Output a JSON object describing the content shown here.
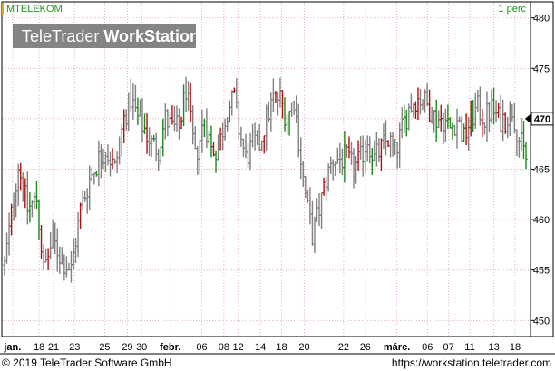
{
  "header": {
    "symbol": "MTELEKOM",
    "interval": "1 perc"
  },
  "watermark": {
    "brand_light": "TeleTrader",
    "brand_bold": "WorkStation"
  },
  "footer": {
    "copyright": "© 2019 TeleTrader Software GmbH",
    "url": "https://workstation.teletrader.com"
  },
  "colors": {
    "up": "#1a8a1a",
    "down": "#b01010",
    "neutral": "#808080",
    "grid": "#e6b3b3",
    "header_text": "#1a9a1a",
    "watermark_bg": "#7a7a7a",
    "symbol_marker": "#f0a020",
    "last_price_marker": "#000000"
  },
  "chart_data": {
    "type": "ohlc",
    "title": "MTELEKOM",
    "interval": "1 perc",
    "xlabel": "",
    "ylabel": "",
    "ylim": [
      448.5,
      481.5
    ],
    "y_ticks": [
      450,
      455,
      460,
      465,
      470,
      475,
      480
    ],
    "last_price": 470,
    "grid": true,
    "x_ticks": [
      {
        "label": "jan.",
        "bold": true,
        "pos": 0.02
      },
      {
        "label": "18",
        "bold": false,
        "pos": 0.074
      },
      {
        "label": "21",
        "bold": false,
        "pos": 0.103
      },
      {
        "label": "23",
        "bold": false,
        "pos": 0.146
      },
      {
        "label": "25",
        "bold": false,
        "pos": 0.207
      },
      {
        "label": "29",
        "bold": false,
        "pos": 0.253
      },
      {
        "label": "30",
        "bold": false,
        "pos": 0.282
      },
      {
        "label": "febr.",
        "bold": true,
        "pos": 0.34
      },
      {
        "label": "06",
        "bold": false,
        "pos": 0.404
      },
      {
        "label": "08",
        "bold": false,
        "pos": 0.449
      },
      {
        "label": "12",
        "bold": false,
        "pos": 0.478
      },
      {
        "label": "14",
        "bold": false,
        "pos": 0.523
      },
      {
        "label": "18",
        "bold": false,
        "pos": 0.566
      },
      {
        "label": "20",
        "bold": false,
        "pos": 0.612
      },
      {
        "label": "22",
        "bold": false,
        "pos": 0.692
      },
      {
        "label": "26",
        "bold": false,
        "pos": 0.736
      },
      {
        "label": "márc.",
        "bold": true,
        "pos": 0.8
      },
      {
        "label": "06",
        "bold": false,
        "pos": 0.862
      },
      {
        "label": "07",
        "bold": false,
        "pos": 0.905
      },
      {
        "label": "11",
        "bold": false,
        "pos": 0.948
      },
      {
        "label": "13",
        "bold": false,
        "pos": 0.997
      },
      {
        "label": "18",
        "bold": false,
        "pos": 1.04
      }
    ],
    "anchors": [
      [
        0,
        455.5
      ],
      [
        6,
        465.5
      ],
      [
        10,
        461
      ],
      [
        14,
        462
      ],
      [
        17,
        455
      ],
      [
        21,
        458
      ],
      [
        25,
        456
      ],
      [
        29,
        455
      ],
      [
        33,
        461
      ],
      [
        37,
        464
      ],
      [
        41,
        466
      ],
      [
        44,
        467
      ],
      [
        48,
        465
      ],
      [
        52,
        470
      ],
      [
        55,
        472
      ],
      [
        58,
        470
      ],
      [
        61,
        469
      ],
      [
        64,
        467.5
      ],
      [
        67,
        467
      ],
      [
        70,
        470
      ],
      [
        73,
        469
      ],
      [
        76,
        469
      ],
      [
        79,
        473
      ],
      [
        83,
        466
      ],
      [
        87,
        470
      ],
      [
        90,
        467
      ],
      [
        93,
        467
      ],
      [
        97,
        471
      ],
      [
        100,
        472
      ],
      [
        102,
        469
      ],
      [
        105,
        466
      ],
      [
        108,
        467.5
      ],
      [
        111,
        467.5
      ],
      [
        114,
        470
      ],
      [
        117,
        472
      ],
      [
        120,
        472
      ],
      [
        123,
        470
      ],
      [
        126,
        472
      ],
      [
        128,
        468
      ],
      [
        130,
        464
      ],
      [
        132,
        461
      ],
      [
        134,
        458.5
      ],
      [
        137,
        461
      ],
      [
        140,
        464
      ],
      [
        143,
        466
      ],
      [
        146,
        466
      ],
      [
        149,
        466
      ],
      [
        152,
        465
      ],
      [
        155,
        466
      ],
      [
        158,
        468
      ],
      [
        161,
        466
      ],
      [
        164,
        467
      ],
      [
        167,
        468
      ],
      [
        170,
        466.5
      ],
      [
        173,
        469
      ],
      [
        176,
        471
      ],
      [
        179,
        472
      ],
      [
        182,
        472
      ],
      [
        185,
        471
      ],
      [
        188,
        470
      ],
      [
        191,
        470
      ],
      [
        194,
        469
      ],
      [
        197,
        470
      ],
      [
        200,
        468
      ],
      [
        203,
        470
      ],
      [
        206,
        471
      ],
      [
        209,
        470
      ],
      [
        212,
        471
      ],
      [
        215,
        470
      ],
      [
        218,
        470
      ],
      [
        221,
        471
      ],
      [
        224,
        468
      ],
      [
        227,
        466
      ]
    ]
  }
}
